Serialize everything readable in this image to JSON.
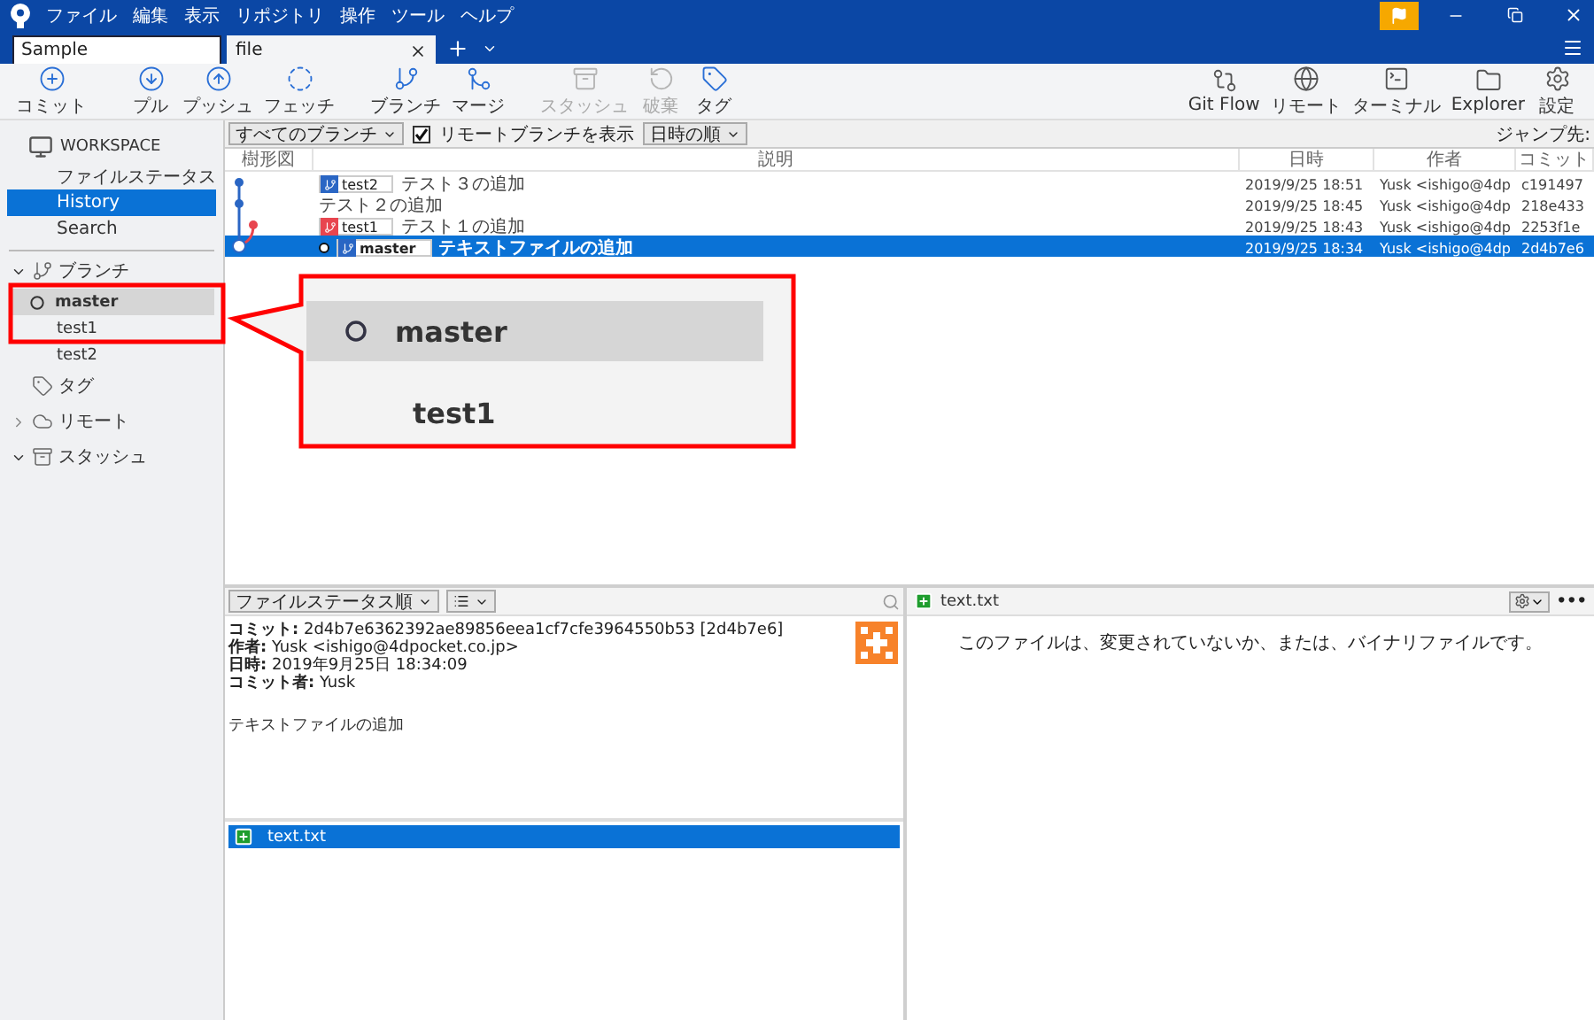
{
  "menu": [
    "ファイル",
    "編集",
    "表示",
    "リポジトリ",
    "操作",
    "ツール",
    "ヘルプ"
  ],
  "tabs": [
    {
      "label": "Sample",
      "selected": false
    },
    {
      "label": "file",
      "selected": true
    }
  ],
  "toolbar": {
    "left": [
      {
        "label": "コミット",
        "disabled": false
      },
      {
        "label": "プル",
        "disabled": false
      },
      {
        "label": "プッシュ",
        "disabled": false
      },
      {
        "label": "フェッチ",
        "disabled": false
      },
      {
        "label": "ブランチ",
        "disabled": false
      },
      {
        "label": "マージ",
        "disabled": false
      },
      {
        "label": "スタッシュ",
        "disabled": true
      },
      {
        "label": "破棄",
        "disabled": true
      },
      {
        "label": "タグ",
        "disabled": false
      }
    ],
    "right": [
      {
        "label": "Git Flow",
        "disabled": false
      },
      {
        "label": "リモート",
        "disabled": false
      },
      {
        "label": "ターミナル",
        "disabled": false
      },
      {
        "label": "Explorer",
        "disabled": false
      },
      {
        "label": "設定",
        "disabled": false
      }
    ]
  },
  "sidebar": {
    "workspace": "WORKSPACE",
    "workspace_items": [
      {
        "label": "ファイルステータス",
        "selected": false
      },
      {
        "label": "History",
        "selected": true
      },
      {
        "label": "Search",
        "selected": false
      }
    ],
    "sections": [
      {
        "label": "ブランチ",
        "expanded": true,
        "children": [
          {
            "label": "master",
            "current": true,
            "selected": true
          },
          {
            "label": "test1",
            "current": false,
            "selected": false
          },
          {
            "label": "test2",
            "current": false,
            "selected": false
          }
        ]
      },
      {
        "label": "タグ"
      },
      {
        "label": "リモート",
        "expanded": false
      },
      {
        "label": "スタッシュ",
        "expanded": true
      }
    ]
  },
  "history": {
    "branch_filter": "すべてのブランチ",
    "show_remote": {
      "label": "リモートブランチを表示",
      "checked": true
    },
    "sort": "日時の順",
    "jump_label": "ジャンプ先:",
    "columns": [
      "樹形図",
      "説明",
      "日時",
      "作者",
      "コミット"
    ],
    "rows": [
      {
        "branch": {
          "label": "test2",
          "color": "#2a66c4",
          "current": false
        },
        "description": "テスト３の追加",
        "date": "2019/9/25  18:51",
        "author": "Yusk <ishigo@4dp",
        "commit": "c191497",
        "selected": false
      },
      {
        "description": "テスト２の追加",
        "date": "2019/9/25  18:45",
        "author": "Yusk <ishigo@4dp",
        "commit": "218e433",
        "selected": false
      },
      {
        "branch": {
          "label": "test1",
          "color": "#e8454f",
          "current": false
        },
        "description": "テスト１の追加",
        "date": "2019/9/25  18:43",
        "author": "Yusk <ishigo@4dp",
        "commit": "2253f1e",
        "selected": false
      },
      {
        "branch": {
          "label": "master",
          "color": "#2a66c4",
          "current": true
        },
        "description": "テキストファイルの追加",
        "date": "2019/9/25  18:34",
        "author": "Yusk <ishigo@4dp",
        "commit": "2d4b7e6",
        "selected": true
      }
    ]
  },
  "details": {
    "sort": "ファイルステータス順",
    "lines": [
      "**コミット:** 2d4b7e6362392ae89856eea1cf7cfe3964550b53 [2d4b7e6]",
      "**作者:** Yusk <ishigo@4dpocket.co.jp>",
      "**日時:** 2019年9月25日 18:34:09",
      "**コミット者:** Yusk"
    ],
    "message": "テキストファイルの追加",
    "files": [
      {
        "name": "text.txt",
        "selected": true
      }
    ]
  },
  "diff": {
    "file": {
      "name": "text.txt"
    },
    "more": "•••",
    "message": "このファイルは、変更されていないか、または、バイナリファイルです。"
  },
  "callout": {
    "items": [
      {
        "label": "master",
        "current": true,
        "selected": true
      },
      {
        "label": "test1",
        "current": false,
        "selected": false
      }
    ]
  }
}
